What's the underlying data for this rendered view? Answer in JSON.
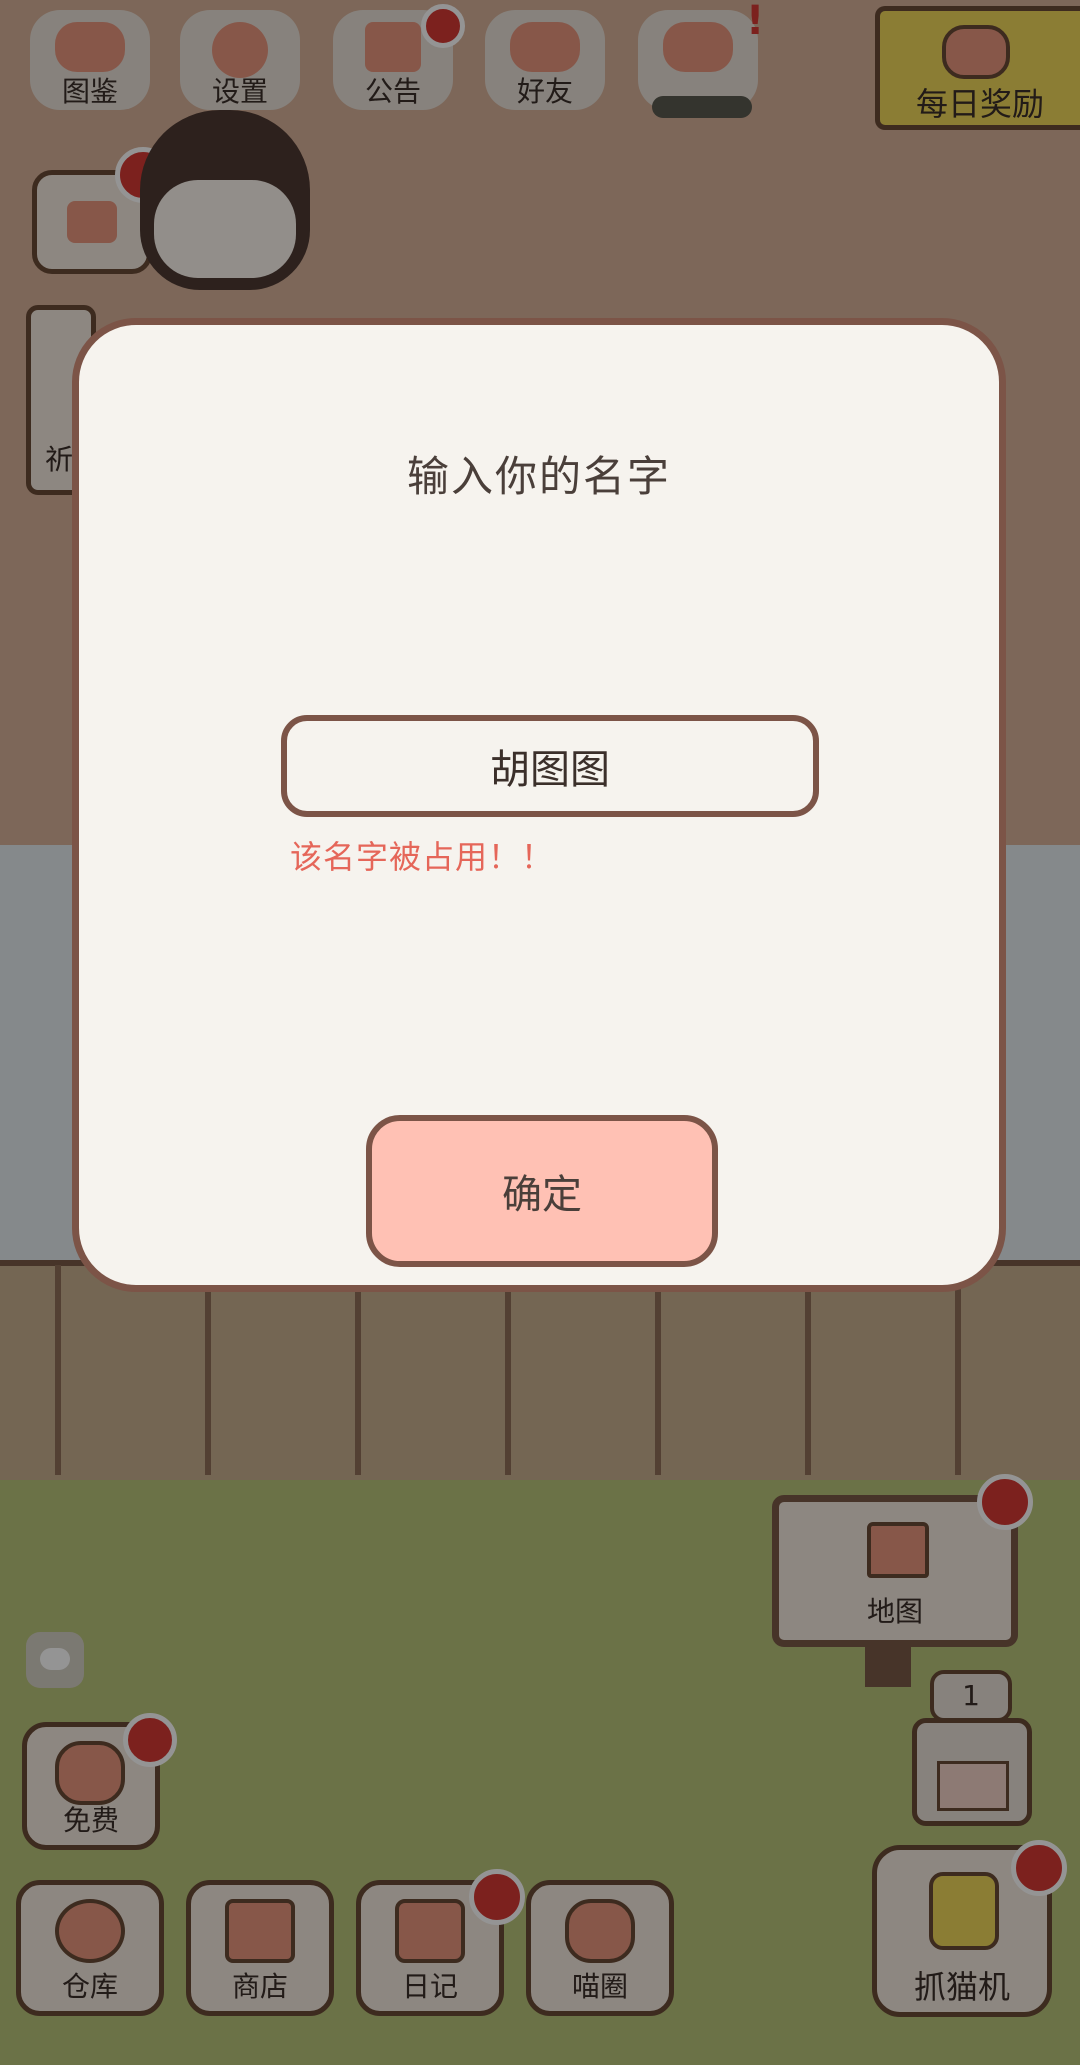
{
  "top_bar": {
    "items": [
      {
        "label": "图鉴",
        "icon": "cat-face-icon"
      },
      {
        "label": "设置",
        "icon": "gear-icon"
      },
      {
        "label": "公告",
        "icon": "gift-icon"
      },
      {
        "label": "好友",
        "icon": "friends-icon"
      },
      {
        "label": "",
        "icon": "heart-fish-icon"
      }
    ],
    "daily_reward_label": "每日奖励"
  },
  "left_panel": {
    "partial_label": "祈"
  },
  "dialog": {
    "title": "输入你的名字",
    "name_value": "胡图图",
    "error_message": "该名字被占用！！",
    "confirm_label": "确定"
  },
  "map_sign": {
    "label": "地图"
  },
  "claw": {
    "count": "1",
    "label": "抓猫机"
  },
  "free": {
    "label": "免费"
  },
  "bottom_bar": {
    "items": [
      {
        "label": "仓库",
        "icon": "bag-icon"
      },
      {
        "label": "商店",
        "icon": "shop-icon"
      },
      {
        "label": "日记",
        "icon": "diary-icon"
      },
      {
        "label": "喵圈",
        "icon": "cat-planet-icon"
      }
    ]
  },
  "colors": {
    "dialog_bg": "#f6f3ee",
    "dialog_border": "#7c5447",
    "confirm_bg": "#ffc1b4",
    "error": "#e56659",
    "badge": "#d63a34"
  }
}
